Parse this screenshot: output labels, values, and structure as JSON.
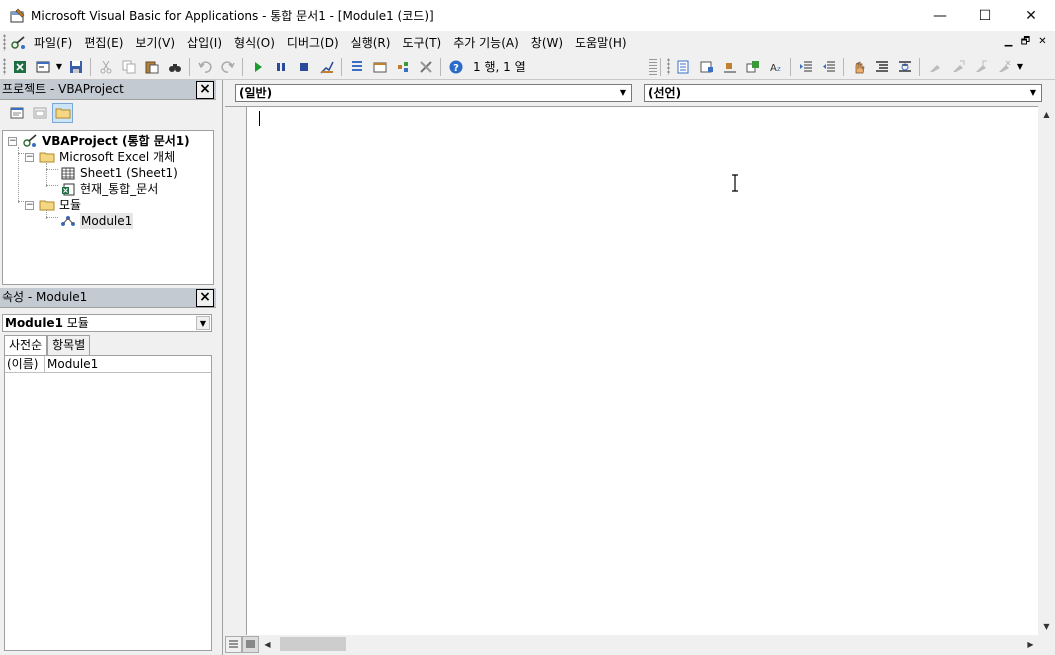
{
  "window": {
    "title": "Microsoft Visual Basic for Applications - 통합 문서1 - [Module1 (코드)]",
    "controls": {
      "minimize": "—",
      "maximize": "☐",
      "close": "✕"
    }
  },
  "menu": {
    "items": [
      {
        "label": "파일(F)"
      },
      {
        "label": "편집(E)"
      },
      {
        "label": "보기(V)"
      },
      {
        "label": "삽입(I)"
      },
      {
        "label": "형식(O)"
      },
      {
        "label": "디버그(D)"
      },
      {
        "label": "실행(R)"
      },
      {
        "label": "도구(T)"
      },
      {
        "label": "추가 기능(A)"
      },
      {
        "label": "창(W)"
      },
      {
        "label": "도움말(H)"
      }
    ],
    "mdi_controls": {
      "minimize": "▁",
      "restore": "🗗",
      "close": "✕"
    }
  },
  "toolbar": {
    "position": "1 행, 1 열",
    "icons": [
      "excel-icon",
      "insert-userform-icon",
      "save-icon",
      "cut-icon",
      "copy-icon",
      "paste-icon",
      "find-icon",
      "undo-icon",
      "redo-icon",
      "run-icon",
      "break-icon",
      "reset-icon",
      "design-mode-icon",
      "project-explorer-icon",
      "properties-window-icon",
      "object-browser-icon",
      "toolbox-icon",
      "help-icon"
    ],
    "edit_icons": [
      "list-properties-icon",
      "list-constants-icon",
      "quick-info-icon",
      "parameter-info-icon",
      "complete-word-icon",
      "indent-icon",
      "outdent-icon",
      "toggle-breakpoint-icon",
      "comment-block-icon",
      "uncomment-block-icon",
      "toggle-bookmark-icon",
      "next-bookmark-icon",
      "prev-bookmark-icon",
      "clear-bookmarks-icon"
    ]
  },
  "project_panel": {
    "title": "프로젝트 - VBAProject",
    "close": "×",
    "tree": {
      "root": "VBAProject (통합 문서1)",
      "excel_objects_folder": "Microsoft Excel 개체",
      "sheet1": "Sheet1 (Sheet1)",
      "workbook": "현재_통합_문서",
      "modules_folder": "모듈",
      "module1": "Module1",
      "toggle_minus": "−"
    }
  },
  "properties_panel": {
    "title": "속성 - Module1",
    "close": "×",
    "object_name": "Module1",
    "object_type": "모듈",
    "tabs": [
      "사전순",
      "항목별"
    ],
    "rows": [
      {
        "key": "(이름)",
        "value": "Module1"
      }
    ]
  },
  "code_window": {
    "object_combo": "(일반)",
    "procedure_combo": "(선언)"
  },
  "colors": {
    "panel_title_bg": "#c4cad2",
    "accent": "#0078d7",
    "run_green": "#1c9b2e"
  }
}
